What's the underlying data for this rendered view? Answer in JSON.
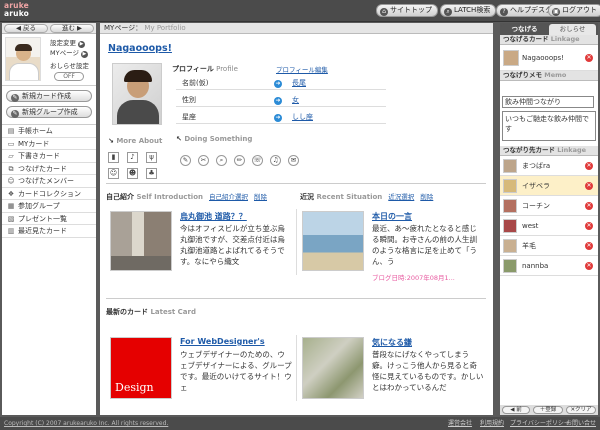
{
  "header": {
    "logo_line1": "aruke",
    "logo_line2": "aruko",
    "buttons": [
      {
        "label": "サイトトップ",
        "icon": "home-icon"
      },
      {
        "label": "LATCH検索",
        "icon": "search-icon"
      },
      {
        "label": "ヘルプデスク",
        "icon": "help-icon"
      },
      {
        "label": "ログアウト",
        "icon": "logout-icon"
      }
    ]
  },
  "left": {
    "back_label": "◀ 戻る",
    "forward_label": "進む ▶",
    "profile_links": [
      "設定変更",
      "MYページ"
    ],
    "oshirase_label": "おしらせ設定",
    "off_label": "OFF",
    "new_card_label": "新規カード作成",
    "new_group_label": "新規グループ作成",
    "menu": [
      {
        "label": "手帳ホーム",
        "icon": "notebook-icon"
      },
      {
        "label": "MYカード",
        "icon": "card-icon"
      },
      {
        "label": "下書きカード",
        "icon": "draft-icon"
      },
      {
        "label": "つなげたカード",
        "icon": "link-card-icon"
      },
      {
        "label": "つなげたメンバー",
        "icon": "members-icon"
      },
      {
        "label": "カードコレクション",
        "icon": "collection-icon"
      },
      {
        "label": "参加グループ",
        "icon": "group-icon"
      },
      {
        "label": "プレゼント一覧",
        "icon": "present-icon"
      },
      {
        "label": "最近見たカード",
        "icon": "recent-icon"
      }
    ]
  },
  "center": {
    "crumb_main": "MYページ：",
    "crumb_sub": "My Portfolio",
    "title": "Nagaooops!",
    "profile": {
      "heading": "プロフィール",
      "heading_sub": "Profile",
      "edit_link": "プロフィール編集",
      "rows": [
        {
          "key": "名前(仮)",
          "value": "長尾"
        },
        {
          "key": "性別",
          "value": "女"
        },
        {
          "key": "星座",
          "value": "しし座"
        }
      ]
    },
    "more_about": "More About",
    "doing_something": "Doing Something",
    "self_intro": {
      "heading": "自己紹介",
      "heading_sub": "Self Introduction",
      "link1": "自己紹介選択",
      "link2": "削除",
      "title": "烏丸御池 道路？？",
      "text": "今はオフィスビルが立ち並ぶ烏丸御池ですが、交差点付近は烏丸御池道路とよばれてるそうです。なにやら織文"
    },
    "recent": {
      "heading": "近況",
      "heading_sub": "Recent Situation",
      "link1": "近況選択",
      "link2": "削除",
      "title": "本日の一言",
      "text": "最近、あ～疲れたとなると感じる瞬間。お寺さんの前の人生訓のような格言に足を止めて「うん、う",
      "date": "ブログ日時:2007年08月1..."
    },
    "latest": {
      "heading": "最新のカード",
      "heading_sub": "Latest Card",
      "card1_title": "For WebDesigner's",
      "card1_text": "ウェブデザイナーのための、ウェブデザイナーによる、グループです。最近のいけてるサイト！ウェ",
      "card1_image_text": "Design",
      "card2_title": "気になる鎌",
      "card2_text": "普段なにげなくやってしまう癖。けっこう他人から見ると奇怪に見えているものです。かしいとはわかっているんだ"
    }
  },
  "right": {
    "tab_active": "つなげる",
    "tab_inactive": "おしらせ",
    "link_card_heading": "つなげるカード",
    "link_card_heading_sub": "Linkage",
    "link_card_item": "Nagaooops!",
    "memo_heading": "つなげりメモ",
    "memo_heading_sub": "Memo",
    "memo_input": "飲み仲間つながり",
    "memo_text": "いつもご馳走な飲み仲間です",
    "linked_heading": "つながり先カード",
    "linked_heading_sub": "Linkage",
    "linked": [
      "まつばra",
      "イザベラ",
      "コーチン",
      "west",
      "羊毛",
      "nannba"
    ],
    "btn1": "◀ 前",
    "btn2": "＋登録",
    "btn3": "✕クリア"
  },
  "footer": {
    "copyright": "Copyright (C) 2007 arukearuko Inc. All rights reserved.",
    "links": [
      "運営会社",
      "利用規約",
      "プライバシーポリシー",
      "お問い合せ"
    ]
  },
  "colors": {
    "accent_blue": "#1e5aa8",
    "delete_red": "#e03a3a",
    "highlight_row": "#fdf0c8",
    "pink_date": "#e85aa0"
  }
}
